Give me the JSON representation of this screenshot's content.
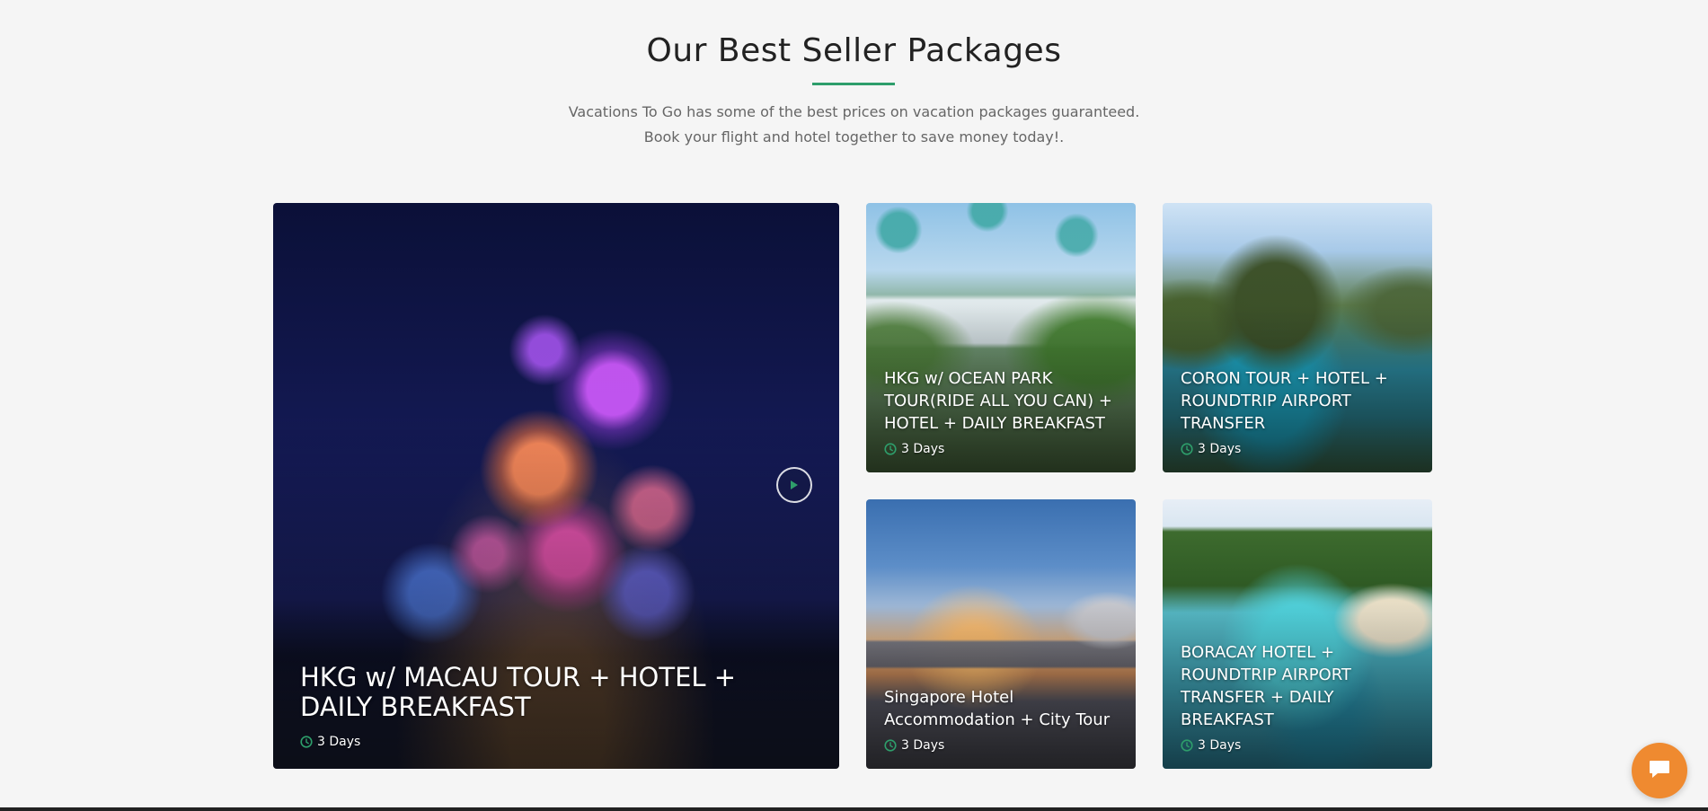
{
  "section": {
    "title": "Our Best Seller Packages",
    "subtitle_line1": "Vacations To Go has some of the best prices on vacation packages guaranteed.",
    "subtitle_line2": "Book your flight and hotel together to save money today!."
  },
  "colors": {
    "accent": "#2e9e6b",
    "chat_button": "#ef8a30"
  },
  "packages": [
    {
      "title": "HKG w/ MACAU TOUR + HOTEL + DAILY BREAKFAST",
      "duration": "3 Days"
    },
    {
      "title": "HKG w/ OCEAN PARK TOUR(RIDE ALL YOU CAN) + HOTEL + DAILY BREAKFAST",
      "duration": "3 Days"
    },
    {
      "title": "CORON TOUR + HOTEL + ROUNDTRIP AIRPORT TRANSFER",
      "duration": "3 Days"
    },
    {
      "title": "Singapore Hotel Accommodation + City Tour",
      "duration": "3 Days"
    },
    {
      "title": "BORACAY HOTEL + ROUNDTRIP AIRPORT TRANSFER + DAILY BREAKFAST",
      "duration": "3 Days"
    }
  ],
  "icons": {
    "duration": "clock-icon",
    "video": "play-icon",
    "chat": "chat-bubble-icon"
  }
}
